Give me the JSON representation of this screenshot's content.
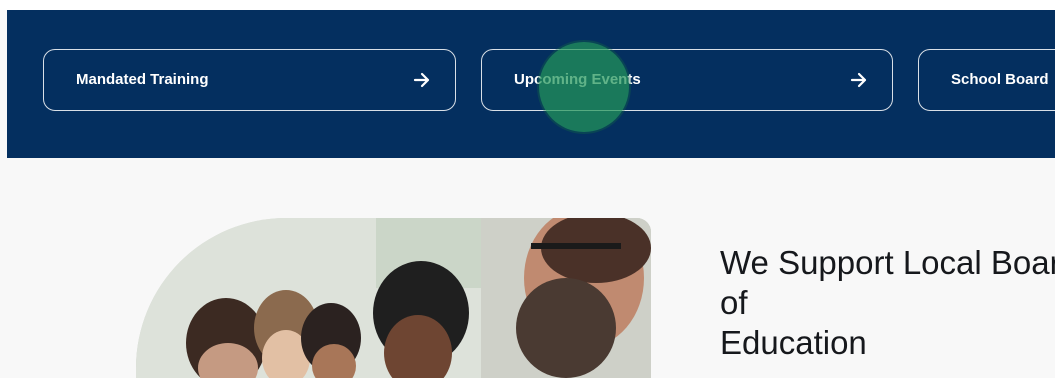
{
  "nav_links": [
    {
      "label": "Mandated Training",
      "icon": "arrow-right-icon"
    },
    {
      "label": "Upcoming Events",
      "icon": "arrow-right-icon"
    },
    {
      "label": "School Board",
      "icon": "arrow-right-icon"
    }
  ],
  "hero": {
    "title_line1": "We Support Local Boards of",
    "title_line2": "Education",
    "image": "photo of smiling people at a training session"
  },
  "colors": {
    "nav_background": "#042f5f",
    "card_border": "#ffffff",
    "page_background": "#f8f8f8",
    "click_marker": "#22965a"
  }
}
